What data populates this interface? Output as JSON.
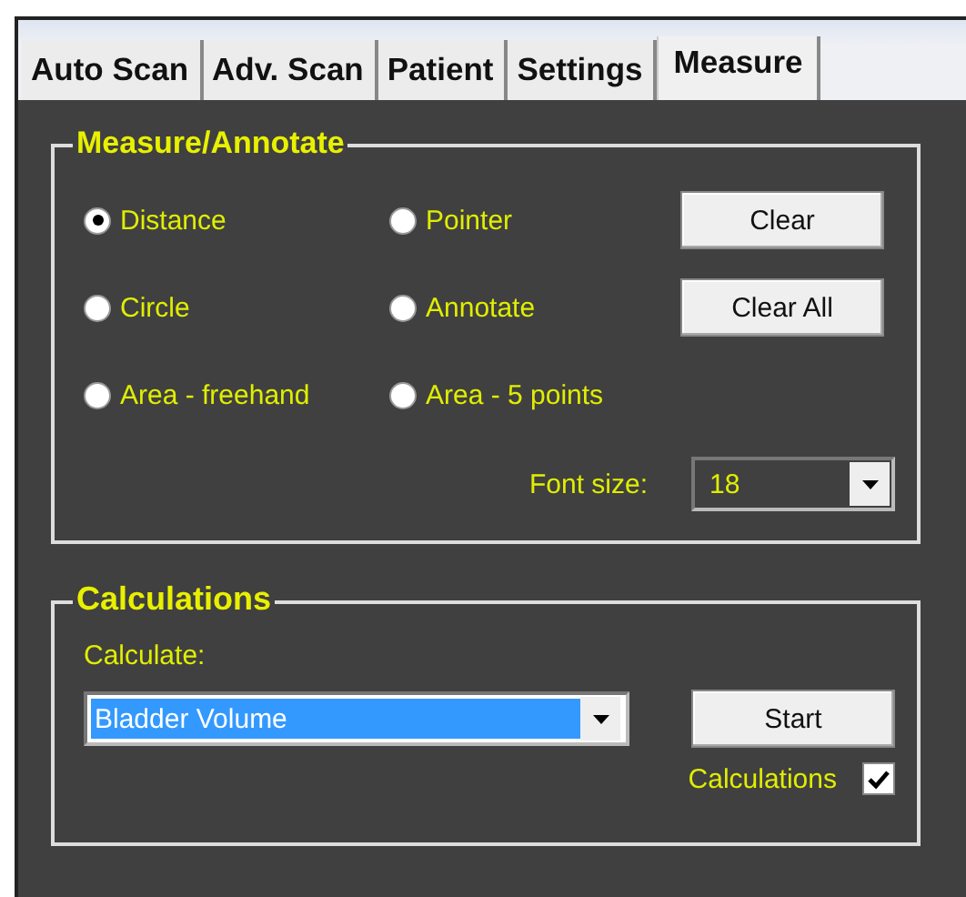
{
  "tabs": [
    {
      "label": "Auto Scan",
      "selected": false
    },
    {
      "label": "Adv. Scan",
      "selected": false
    },
    {
      "label": "Patient",
      "selected": false
    },
    {
      "label": "Settings",
      "selected": false
    },
    {
      "label": "Measure",
      "selected": true
    }
  ],
  "measure_group": {
    "title": "Measure/Annotate",
    "options": [
      {
        "label": "Distance",
        "selected": true
      },
      {
        "label": "Pointer",
        "selected": false
      },
      {
        "label": "Circle",
        "selected": false
      },
      {
        "label": "Annotate",
        "selected": false
      },
      {
        "label": "Area - freehand",
        "selected": false
      },
      {
        "label": "Area - 5 points",
        "selected": false
      }
    ],
    "buttons": [
      "Clear",
      "Clear All"
    ],
    "font_size": {
      "label": "Font size:",
      "value": "18"
    }
  },
  "calculations_group": {
    "title": "Calculations",
    "calculate_label": "Calculate:",
    "calculate_value": "Bladder Volume",
    "start_button": "Start",
    "checkbox": {
      "label": "Calculations",
      "checked": true
    }
  }
}
